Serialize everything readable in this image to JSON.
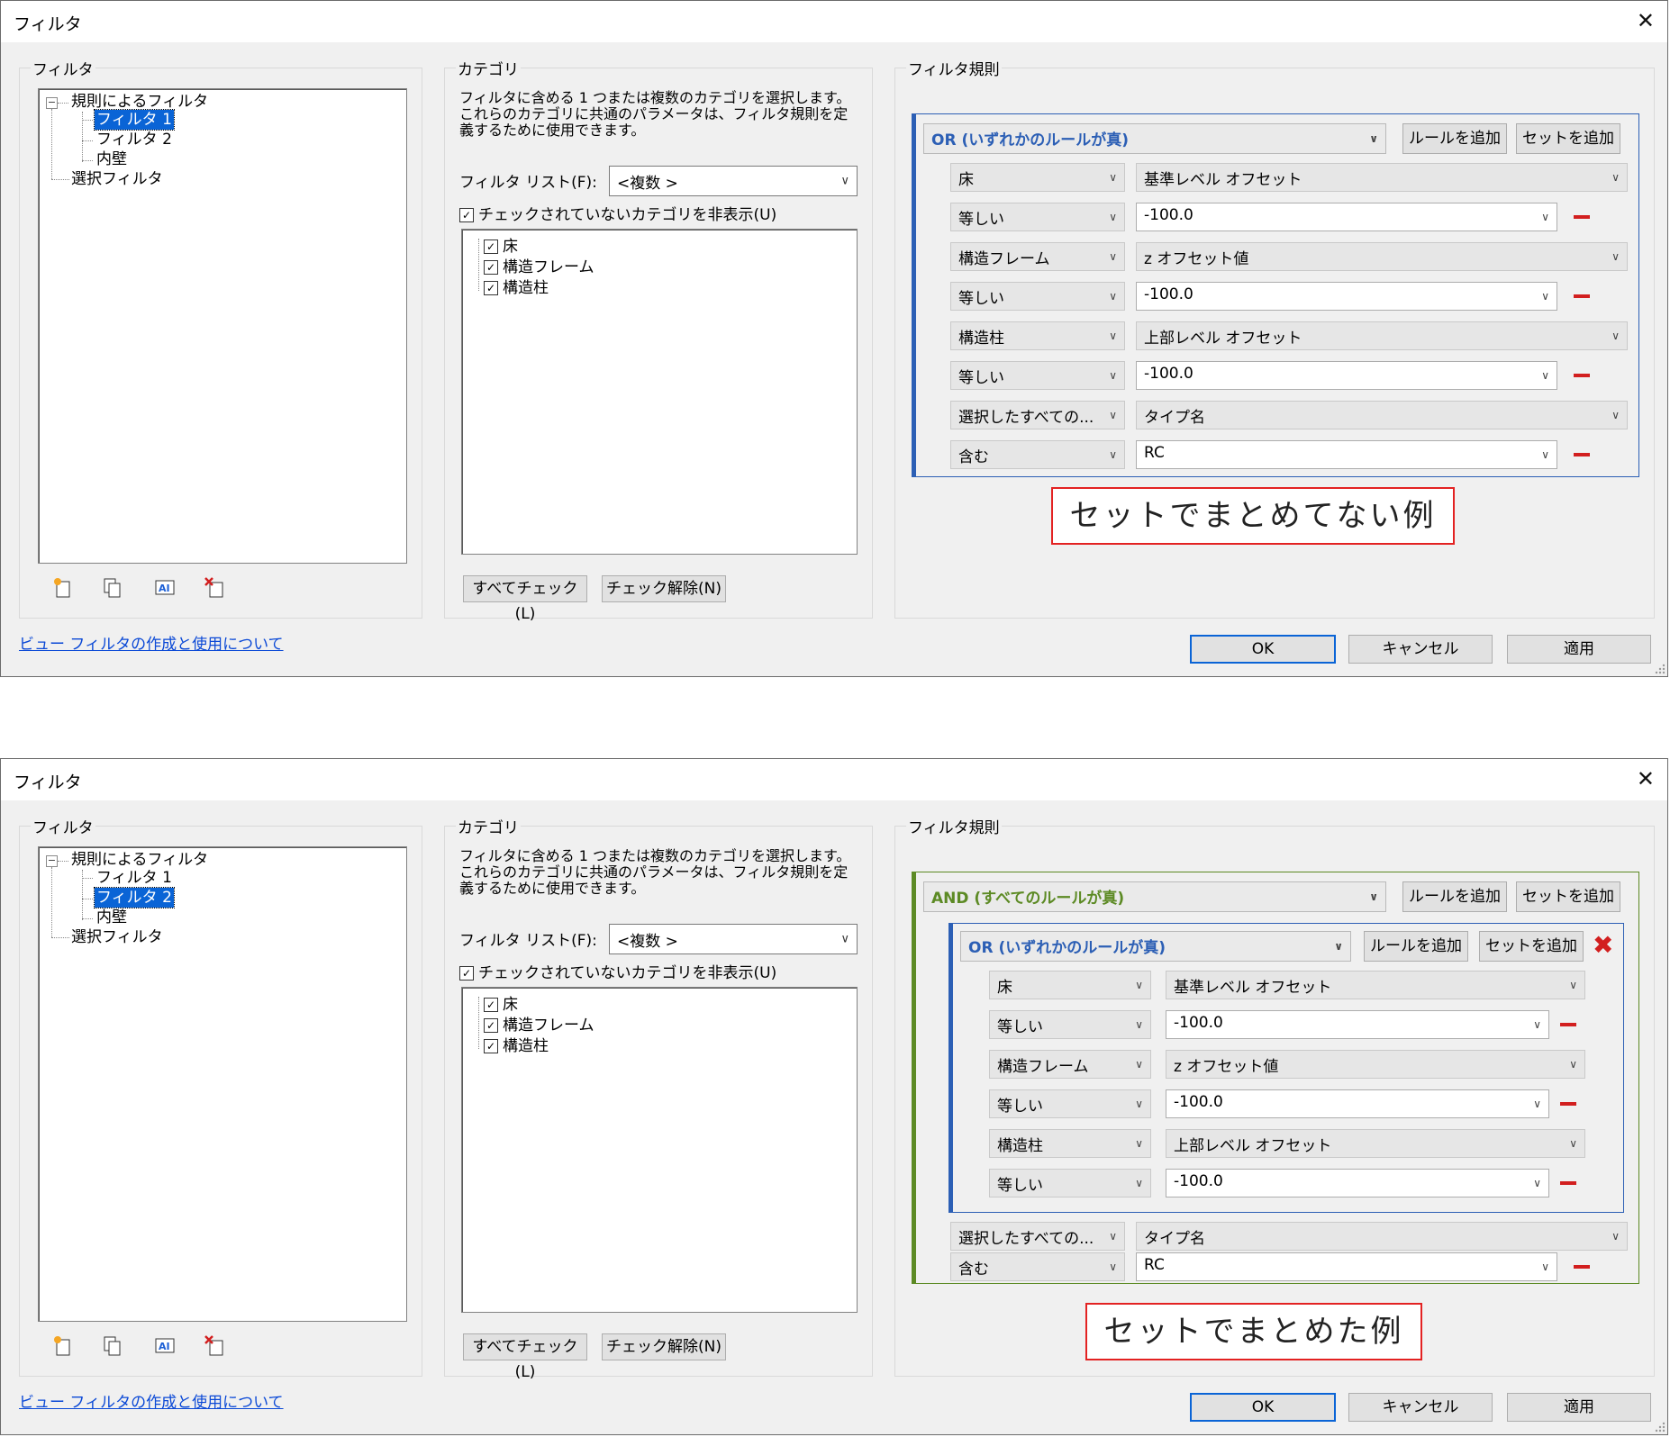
{
  "dialogs": [
    {
      "title": "フィルタ",
      "filters_group": {
        "label": "フィルタ",
        "tree": {
          "root": "規則によるフィルタ",
          "children": [
            "フィルタ 1",
            "フィルタ 2",
            "内壁"
          ],
          "selected_index": 0,
          "selection_filter": "選択フィルタ"
        },
        "icons": [
          "new-filter-icon",
          "duplicate-filter-icon",
          "rename-filter-icon",
          "delete-filter-icon"
        ]
      },
      "help_link": "ビュー フィルタの作成と使用について",
      "category_group": {
        "label": "カテゴリ",
        "description": "フィルタに含める 1 つまたは複数のカテゴリを選択します。これらのカテゴリに共通のパラメータは、フィルタ規則を定義するために使用できます。",
        "filter_list_label": "フィルタ リスト(F):",
        "filter_list_value": "<複数 >",
        "hide_unchecked_label": "チェックされていないカテゴリを非表示(U)",
        "categories": [
          "床",
          "構造フレーム",
          "構造柱"
        ],
        "check_all": "すべてチェック(L)",
        "uncheck_all": "チェック解除(N)"
      },
      "rules_group": {
        "label": "フィルタ規則",
        "header": "OR (いずれかのルールが真)",
        "add_rule": "ルールを追加",
        "add_set": "セットを追加",
        "rules": [
          {
            "param_left": "床",
            "param_right": "基準レベル オフセット",
            "op": "等しい",
            "value": "-100.0"
          },
          {
            "param_left": "構造フレーム",
            "param_right": "z オフセット値",
            "op": "等しい",
            "value": "-100.0"
          },
          {
            "param_left": "構造柱",
            "param_right": "上部レベル オフセット",
            "op": "等しい",
            "value": "-100.0"
          },
          {
            "param_left": "選択したすべての...",
            "param_right": "タイプ名",
            "op": "含む",
            "value": "RC"
          }
        ]
      },
      "caption": "セットでまとめてない例",
      "buttons": {
        "ok": "OK",
        "cancel": "キャンセル",
        "apply": "適用"
      },
      "colors": {
        "frame": "#2c5fb5"
      }
    },
    {
      "title": "フィルタ",
      "filters_group": {
        "label": "フィルタ",
        "tree": {
          "root": "規則によるフィルタ",
          "children": [
            "フィルタ 1",
            "フィルタ 2",
            "内壁"
          ],
          "selected_index": 1,
          "selection_filter": "選択フィルタ"
        },
        "icons": [
          "new-filter-icon",
          "duplicate-filter-icon",
          "rename-filter-icon",
          "delete-filter-icon"
        ]
      },
      "help_link": "ビュー フィルタの作成と使用について",
      "category_group": {
        "label": "カテゴリ",
        "description": "フィルタに含める 1 つまたは複数のカテゴリを選択します。これらのカテゴリに共通のパラメータは、フィルタ規則を定義するために使用できます。",
        "filter_list_label": "フィルタ リスト(F):",
        "filter_list_value": "<複数 >",
        "hide_unchecked_label": "チェックされていないカテゴリを非表示(U)",
        "categories": [
          "床",
          "構造フレーム",
          "構造柱"
        ],
        "check_all": "すべてチェック(L)",
        "uncheck_all": "チェック解除(N)"
      },
      "rules_group": {
        "label": "フィルタ規則",
        "header": "AND (すべてのルールが真)",
        "add_rule": "ルールを追加",
        "add_set": "セットを追加",
        "inner_set": {
          "header": "OR (いずれかのルールが真)",
          "add_rule": "ルールを追加",
          "add_set": "セットを追加",
          "rules": [
            {
              "param_left": "床",
              "param_right": "基準レベル オフセット",
              "op": "等しい",
              "value": "-100.0"
            },
            {
              "param_left": "構造フレーム",
              "param_right": "z オフセット値",
              "op": "等しい",
              "value": "-100.0"
            },
            {
              "param_left": "構造柱",
              "param_right": "上部レベル オフセット",
              "op": "等しい",
              "value": "-100.0"
            }
          ]
        },
        "rules": [
          {
            "param_left": "選択したすべての...",
            "param_right": "タイプ名",
            "op": "含む",
            "value": "RC"
          }
        ]
      },
      "caption": "セットでまとめた例",
      "buttons": {
        "ok": "OK",
        "cancel": "キャンセル",
        "apply": "適用"
      },
      "colors": {
        "frame": "#5c8a24",
        "inner_frame": "#2c5fb5"
      }
    }
  ]
}
